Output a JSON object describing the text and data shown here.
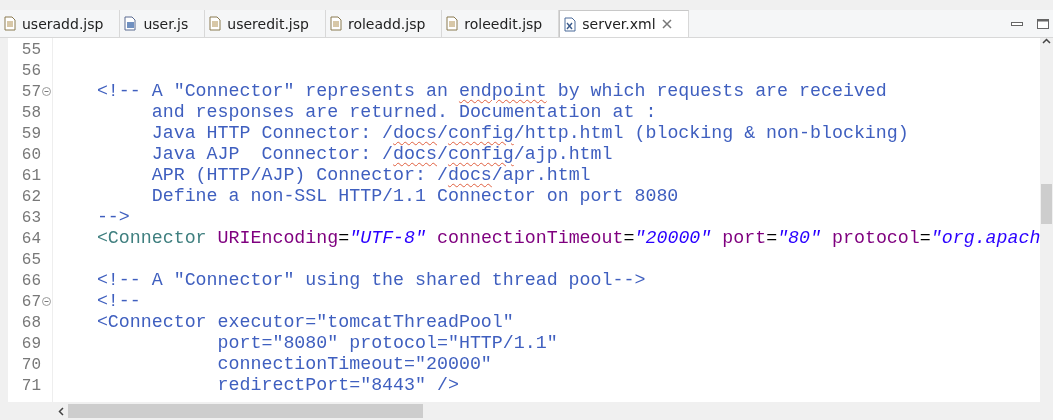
{
  "tabs": [
    {
      "label": "useradd.jsp",
      "kind": "jsp",
      "selected": false
    },
    {
      "label": "user.js",
      "kind": "js",
      "selected": false
    },
    {
      "label": "useredit.jsp",
      "kind": "jsp",
      "selected": false
    },
    {
      "label": "roleadd.jsp",
      "kind": "jsp",
      "selected": false
    },
    {
      "label": "roleedit.jsp",
      "kind": "jsp",
      "selected": false
    },
    {
      "label": "server.xml",
      "kind": "xml",
      "selected": true
    }
  ],
  "editor": {
    "lines": [
      {
        "number": "55"
      },
      {
        "number": "56"
      },
      {
        "number": "57",
        "collapsed": false,
        "tokens": [
          {
            "kind": "comment",
            "text": "    <!-- A \"Connector\" represents an "
          },
          {
            "kind": "comment",
            "text": "endpoint",
            "squiggle": true
          },
          {
            "kind": "comment",
            "text": " by which requests are received"
          }
        ]
      },
      {
        "number": "58",
        "tokens": [
          {
            "kind": "comment",
            "text": "         and responses are returned. Documentation at :"
          }
        ]
      },
      {
        "number": "59",
        "tokens": [
          {
            "kind": "comment",
            "text": "         Java HTTP Connector: /"
          },
          {
            "kind": "comment",
            "text": "docs",
            "squiggle": true
          },
          {
            "kind": "comment",
            "text": "/"
          },
          {
            "kind": "comment",
            "text": "config",
            "squiggle": true
          },
          {
            "kind": "comment",
            "text": "/http.html (blocking & non-blocking)"
          }
        ]
      },
      {
        "number": "60",
        "tokens": [
          {
            "kind": "comment",
            "text": "         Java AJP  Connector: /"
          },
          {
            "kind": "comment",
            "text": "docs",
            "squiggle": true
          },
          {
            "kind": "comment",
            "text": "/"
          },
          {
            "kind": "comment",
            "text": "config",
            "squiggle": true
          },
          {
            "kind": "comment",
            "text": "/ajp.html"
          }
        ]
      },
      {
        "number": "61",
        "tokens": [
          {
            "kind": "comment",
            "text": "         APR (HTTP/AJP) Connector: /"
          },
          {
            "kind": "comment",
            "text": "docs",
            "squiggle": true
          },
          {
            "kind": "comment",
            "text": "/apr.html"
          }
        ]
      },
      {
        "number": "62",
        "tokens": [
          {
            "kind": "comment",
            "text": "         Define a non-SSL HTTP/1.1 Connector on port 8080"
          }
        ]
      },
      {
        "number": "63",
        "tokens": [
          {
            "kind": "comment",
            "text": "    -->"
          }
        ]
      },
      {
        "number": "64",
        "tokens": [
          {
            "kind": "tag",
            "text": "    <Connector"
          },
          {
            "kind": "attr",
            "text": " URIEncoding"
          },
          {
            "kind": "plain",
            "text": "="
          },
          {
            "kind": "value",
            "text": "\"UTF-8\""
          },
          {
            "kind": "attr",
            "text": " connectionTimeout"
          },
          {
            "kind": "plain",
            "text": "="
          },
          {
            "kind": "value",
            "text": "\"20000\""
          },
          {
            "kind": "attr",
            "text": " port"
          },
          {
            "kind": "plain",
            "text": "="
          },
          {
            "kind": "value",
            "text": "\"80\""
          },
          {
            "kind": "attr",
            "text": " protocol"
          },
          {
            "kind": "plain",
            "text": "="
          },
          {
            "kind": "value",
            "text": "\"org.apach"
          }
        ]
      },
      {
        "number": "65"
      },
      {
        "number": "66",
        "tokens": [
          {
            "kind": "comment",
            "text": "    <!-- A \"Connector\" using the shared thread pool-->"
          }
        ]
      },
      {
        "number": "67",
        "collapsed": false,
        "tokens": [
          {
            "kind": "comment",
            "text": "    <!--"
          }
        ]
      },
      {
        "number": "68",
        "tokens": [
          {
            "kind": "comment",
            "text": "    <Connector executor=\"tomcatThreadPool\""
          }
        ]
      },
      {
        "number": "69",
        "tokens": [
          {
            "kind": "comment",
            "text": "               port=\"8080\" protocol=\"HTTP/1.1\""
          }
        ]
      },
      {
        "number": "70",
        "tokens": [
          {
            "kind": "comment",
            "text": "               connectionTimeout=\"20000\""
          }
        ]
      },
      {
        "number": "71",
        "tokens": [
          {
            "kind": "comment",
            "text": "               redirectPort=\"8443\" />"
          }
        ]
      }
    ]
  }
}
